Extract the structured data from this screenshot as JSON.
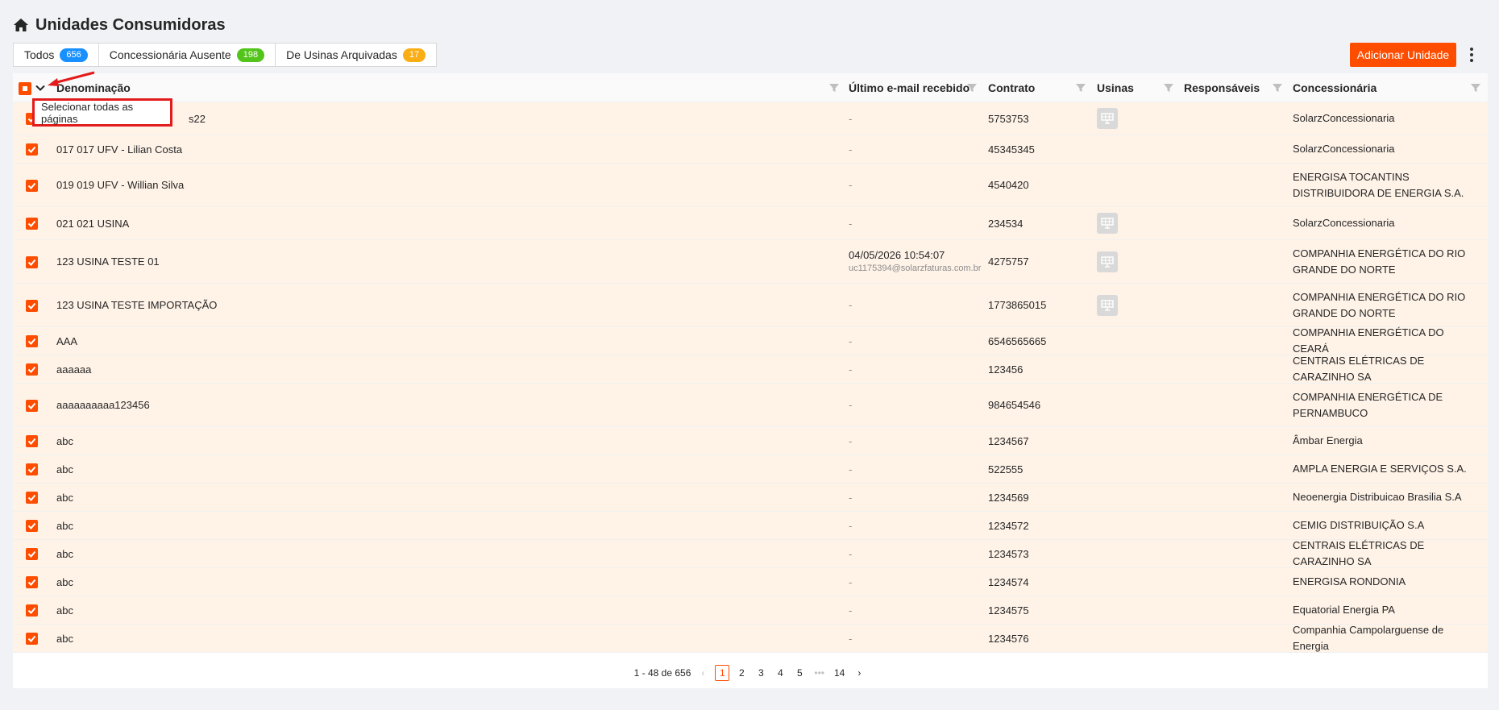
{
  "page": {
    "title": "Unidades Consumidoras"
  },
  "colors": {
    "accent": "#ff4d00",
    "badge_blue": "#1890ff",
    "badge_green": "#52c41a",
    "badge_orange": "#faad14",
    "row_selected": "#fff3e8",
    "annotation_red": "#e31b1b"
  },
  "tabs": [
    {
      "label": "Todos",
      "count": "656",
      "badge_color": "#1890ff"
    },
    {
      "label": "Concessionária Ausente",
      "count": "198",
      "badge_color": "#52c41a"
    },
    {
      "label": "De Usinas Arquivadas",
      "count": "17",
      "badge_color": "#faad14"
    }
  ],
  "toolbar": {
    "add_label": "Adicionar Unidade"
  },
  "columns": {
    "denominacao": "Denominação",
    "email": "Último e-mail recebido",
    "contrato": "Contrato",
    "usinas": "Usinas",
    "responsaveis": "Responsáveis",
    "concessionaria": "Concessionária"
  },
  "popup": {
    "label": "Selecionar todas as páginas"
  },
  "rows": [
    {
      "name": "s22",
      "email_date": "-",
      "email_addr": "",
      "contrato": "5753753",
      "usina": true,
      "concessionaria": "SolarzConcessionaria"
    },
    {
      "name": "017 017 UFV - Lilian Costa",
      "email_date": "-",
      "email_addr": "",
      "contrato": "45345345",
      "usina": false,
      "concessionaria": "SolarzConcessionaria"
    },
    {
      "name": "019 019 UFV - Willian Silva",
      "email_date": "-",
      "email_addr": "",
      "contrato": "4540420",
      "usina": false,
      "concessionaria": "ENERGISA TOCANTINS DISTRIBUIDORA DE ENERGIA S.A."
    },
    {
      "name": "021 021 USINA",
      "email_date": "-",
      "email_addr": "",
      "contrato": "234534",
      "usina": true,
      "concessionaria": "SolarzConcessionaria"
    },
    {
      "name": "123 USINA TESTE 01",
      "email_date": "04/05/2026 10:54:07",
      "email_addr": "uc1175394@solarzfaturas.com.br",
      "contrato": "4275757",
      "usina": true,
      "concessionaria": "COMPANHIA ENERGÉTICA DO RIO GRANDE DO NORTE"
    },
    {
      "name": "123 USINA TESTE IMPORTAÇÃO",
      "email_date": "-",
      "email_addr": "",
      "contrato": "1773865015",
      "usina": true,
      "concessionaria": "COMPANHIA ENERGÉTICA DO RIO GRANDE DO NORTE"
    },
    {
      "name": "AAA",
      "email_date": "-",
      "email_addr": "",
      "contrato": "6546565665",
      "usina": false,
      "concessionaria": "COMPANHIA ENERGÉTICA DO CEARÁ"
    },
    {
      "name": "aaaaaa",
      "email_date": "-",
      "email_addr": "",
      "contrato": "123456",
      "usina": false,
      "concessionaria": "CENTRAIS ELÉTRICAS DE CARAZINHO SA"
    },
    {
      "name": "aaaaaaaaaa123456",
      "email_date": "-",
      "email_addr": "",
      "contrato": "984654546",
      "usina": false,
      "concessionaria": "COMPANHIA ENERGÉTICA DE PERNAMBUCO"
    },
    {
      "name": "abc",
      "email_date": "-",
      "email_addr": "",
      "contrato": "1234567",
      "usina": false,
      "concessionaria": "Âmbar Energia"
    },
    {
      "name": "abc",
      "email_date": "-",
      "email_addr": "",
      "contrato": "522555",
      "usina": false,
      "concessionaria": "AMPLA ENERGIA E SERVIÇOS S.A."
    },
    {
      "name": "abc",
      "email_date": "-",
      "email_addr": "",
      "contrato": "1234569",
      "usina": false,
      "concessionaria": "Neoenergia Distribuicao Brasilia S.A"
    },
    {
      "name": "abc",
      "email_date": "-",
      "email_addr": "",
      "contrato": "1234572",
      "usina": false,
      "concessionaria": "CEMIG DISTRIBUIÇÃO S.A"
    },
    {
      "name": "abc",
      "email_date": "-",
      "email_addr": "",
      "contrato": "1234573",
      "usina": false,
      "concessionaria": "CENTRAIS ELÉTRICAS DE CARAZINHO SA"
    },
    {
      "name": "abc",
      "email_date": "-",
      "email_addr": "",
      "contrato": "1234574",
      "usina": false,
      "concessionaria": "ENERGISA RONDONIA"
    },
    {
      "name": "abc",
      "email_date": "-",
      "email_addr": "",
      "contrato": "1234575",
      "usina": false,
      "concessionaria": "Equatorial Energia PA"
    },
    {
      "name": "abc",
      "email_date": "-",
      "email_addr": "",
      "contrato": "1234576",
      "usina": false,
      "concessionaria": "Companhia Campolarguense de Energia"
    }
  ],
  "pagination": {
    "summary": "1 - 48 de 656",
    "pages": [
      "1",
      "2",
      "3",
      "4",
      "5"
    ],
    "ellipsis": "•••",
    "last": "14",
    "current": "1"
  }
}
